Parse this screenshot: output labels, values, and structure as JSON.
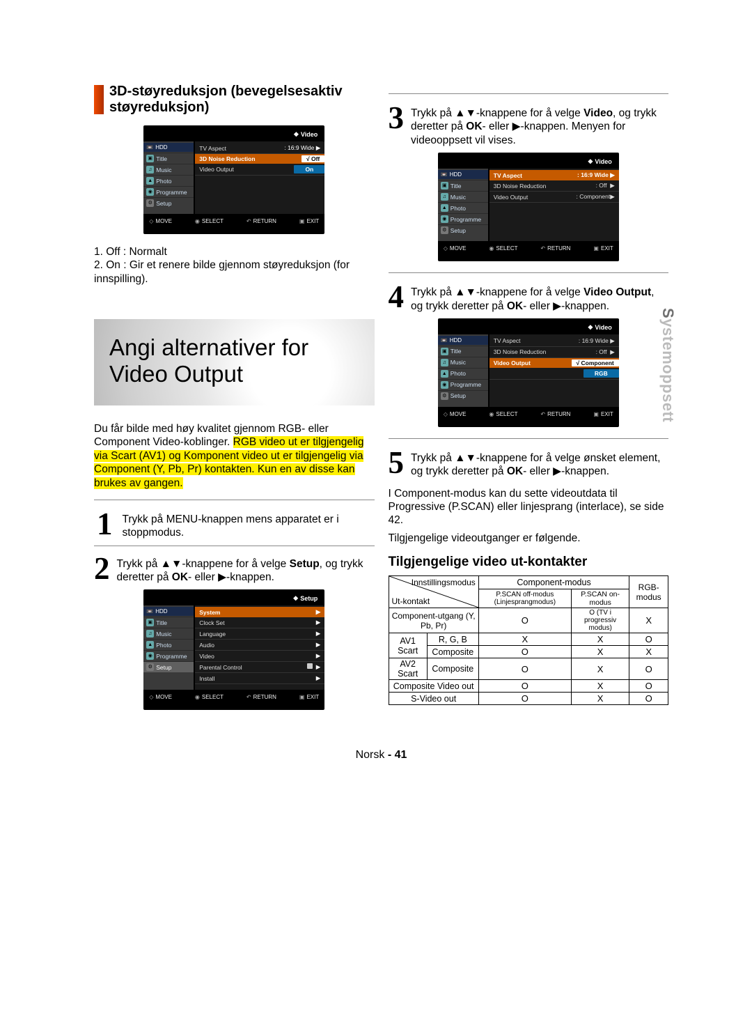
{
  "left": {
    "section_title_l1": "3D-støyreduksjon (bevegelsesaktiv",
    "section_title_l2": "støyreduksjon)",
    "osd1": {
      "crumb": "Video",
      "hdd": "HDD",
      "side": [
        "Title",
        "Music",
        "Photo",
        "Programme",
        "Setup"
      ],
      "rows": [
        {
          "label": "TV Aspect",
          "val": ": 16:9 Wide ",
          "sel": false,
          "style": ""
        },
        {
          "label": "3D Noise Reduction",
          "val": "Off",
          "sel": true,
          "style": "chk"
        },
        {
          "label": "Video Output",
          "val": "On",
          "sel": false,
          "style": "on"
        }
      ],
      "bottom": [
        "MOVE",
        "SELECT",
        "RETURN",
        "EXIT"
      ]
    },
    "list": {
      "i1": "1. Off : Normalt",
      "i2": "2. On : Gir et renere bilde gjennom støyreduksjon (for innspilling)."
    },
    "big_title_l1": "Angi alternativer for",
    "big_title_l2": "Video Output",
    "intro_p1": "Du får bilde med høy kvalitet gjennom RGB- eller Component Video-koblinger.",
    "intro_hl": "RGB video ut er tilgjengelig via Scart (AV1) og Komponent video ut er tilgjengelig via Component (Y, Pb, Pr) kontakten. Kun en av disse kan brukes av gangen.",
    "step1": "Trykk på MENU-knappen mens apparatet er i stoppmodus.",
    "step2_pre": "Trykk på ",
    "step2_mid": "-knappene for å velge ",
    "step2_bold": "Setup",
    "step2_post": ", og trykk deretter på ",
    "step2_bold2": "OK",
    "step2_or": "- eller ",
    "step2_btn": "-knappen.",
    "step1_bold": "MENU",
    "osd2": {
      "crumb": "Setup",
      "hdd": "HDD",
      "side": [
        "Title",
        "Music",
        "Photo",
        "Programme",
        "Setup"
      ],
      "side_sel": 4,
      "rows": [
        {
          "label": "System",
          "val": "√",
          "arrow": true,
          "hi": true
        },
        {
          "label": "Clock Set",
          "arrow": true
        },
        {
          "label": "Language",
          "arrow": true
        },
        {
          "label": "Audio",
          "arrow": true
        },
        {
          "label": "Video",
          "arrow": true
        },
        {
          "label": "Parental Control",
          "lock": true,
          "arrow": true
        },
        {
          "label": "Install",
          "arrow": true
        }
      ],
      "bottom": [
        "MOVE",
        "SELECT",
        "RETURN",
        "EXIT"
      ]
    }
  },
  "right": {
    "step3_pre": "Trykk på ",
    "step3_mid": "-knappene for å velge ",
    "step3_bold": "Video",
    "step3_post": ", og trykk deretter på ",
    "step3_bold2": "OK",
    "step3_or": "- eller ",
    "step3_btn": "-knappen. Menyen for videooppsett vil vises.",
    "osd3": {
      "crumb": "Video",
      "hdd": "HDD",
      "side": [
        "Title",
        "Music",
        "Photo",
        "Programme",
        "Setup"
      ],
      "rows": [
        {
          "label": "TV Aspect",
          "val": ": 16:9 Wide ",
          "sel": true,
          "style": "hi"
        },
        {
          "label": "3D Noise Reduction",
          "val": ": Off",
          "style": ""
        },
        {
          "label": "Video Output",
          "val": ": Component",
          "style": ""
        }
      ],
      "bottom": [
        "MOVE",
        "SELECT",
        "RETURN",
        "EXIT"
      ]
    },
    "step4_pre": "Trykk på ",
    "step4_mid": "-knappene for å velge ",
    "step4_bold": "Video Output",
    "step4_post": ", og trykk deretter på ",
    "step4_bold2": "OK",
    "step4_or": "- eller ",
    "step4_btn": "-knappen.",
    "osd4": {
      "crumb": "Video",
      "hdd": "HDD",
      "side": [
        "Title",
        "Music",
        "Photo",
        "Programme",
        "Setup"
      ],
      "rows": [
        {
          "label": "TV Aspect",
          "val": ": 16:9 Wide ",
          "style": ""
        },
        {
          "label": "3D Noise Reduction",
          "val": ": Off",
          "style": ""
        },
        {
          "label": "Video Output",
          "val": "Component",
          "sel": true,
          "style": "chk"
        },
        {
          "label": "",
          "val": "RGB",
          "style": "on"
        }
      ],
      "bottom": [
        "MOVE",
        "SELECT",
        "RETURN",
        "EXIT"
      ]
    },
    "step5_pre": "Trykk på ",
    "step5_mid": "-knappene for å velge ønsket element, og trykk deretter på ",
    "step5_bold2": "OK",
    "step5_or": "- eller ",
    "step5_btn": "-knappen.",
    "after5_p1": "I Component-modus kan du sette videoutdata til Progressive (P.SCAN) eller linjesprang (interlace), se side 42.",
    "after5_p2": "Tilgjengelige videoutganger er følgende.",
    "table_title": "Tilgjengelige video ut-kontakter",
    "table": {
      "h_mode": "Innstillingsmodus",
      "h_comp": "Component-modus",
      "h_rgb": "RGB-modus",
      "h_out": "Ut-kontakt",
      "h_pscan_off": "P.SCAN off-modus (Linjesprangmodus)",
      "h_pscan_on": "P.SCAN on-modus",
      "rows": [
        {
          "a": "Component-utgang (Y, Pb, Pr)",
          "b": "O",
          "c": "O (TV i progressiv modus)",
          "d": "X"
        },
        {
          "a": "AV1 Scart",
          "sub1": "R, G, B",
          "b1": "X",
          "c1": "X",
          "d1": "O",
          "sub2": "Composite",
          "b2": "O",
          "c2": "X",
          "d2": "X"
        },
        {
          "a": "AV2 Scart",
          "sub": "Composite",
          "b": "O",
          "c": "X",
          "d": "O"
        },
        {
          "a": "Composite Video out",
          "b": "O",
          "c": "X",
          "d": "O"
        },
        {
          "a": "S-Video out",
          "b": "O",
          "c": "X",
          "d": "O"
        }
      ]
    }
  },
  "side_tab_S": "S",
  "side_tab_rest": "ystemoppsett",
  "footer_lang": "Norsk",
  "footer_sep": " - ",
  "footer_pg": "41"
}
